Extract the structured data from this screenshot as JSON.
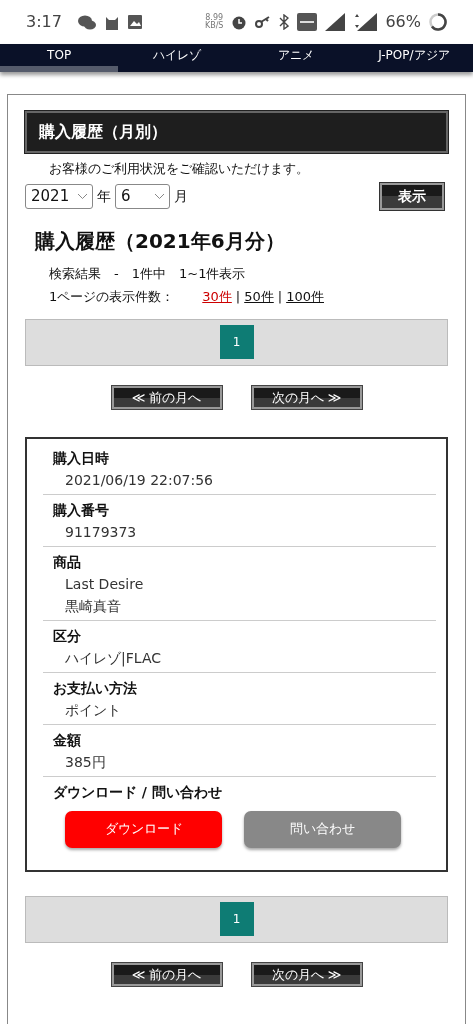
{
  "status_bar": {
    "time": "3:17",
    "net_speed": "8.99",
    "net_unit": "KB/S",
    "battery": "66%"
  },
  "nav_tabs": [
    {
      "label": "TOP",
      "selected": true
    },
    {
      "label": "ハイレゾ",
      "selected": false
    },
    {
      "label": "アニメ",
      "selected": false
    },
    {
      "label": "J-POP/アジア",
      "selected": false
    }
  ],
  "section_title": "購入履歴（月別）",
  "intro": "お客様のご利用状況をご確認いただけます。",
  "filter": {
    "year": "2021",
    "year_unit": "年",
    "month": "6",
    "month_unit": "月",
    "submit": "表示"
  },
  "results_title": "購入履歴（2021年6月分）",
  "result_summary": "検索結果　-　1件中　1~1件表示",
  "per_page_label": "1ページの表示件数：",
  "per_page_separator": "|",
  "per_page_options": [
    {
      "label": "30件",
      "selected": true
    },
    {
      "label": "50件",
      "selected": false
    },
    {
      "label": "100件",
      "selected": false
    }
  ],
  "pagination_top": [
    {
      "label": "1",
      "selected": true
    }
  ],
  "month_nav_top": {
    "prev": "≪ 前の月へ",
    "next": "次の月へ ≫"
  },
  "record": {
    "fields": [
      {
        "label": "購入日時",
        "values": [
          "2021/06/19 22:07:56"
        ]
      },
      {
        "label": "購入番号",
        "values": [
          "91179373"
        ]
      },
      {
        "label": "商品",
        "values": [
          "Last Desire",
          "黒崎真音"
        ]
      },
      {
        "label": "区分",
        "values": [
          "ハイレゾ|FLAC"
        ]
      },
      {
        "label": "お支払い方法",
        "values": [
          "ポイント"
        ]
      },
      {
        "label": "金額",
        "values": [
          "385円"
        ]
      }
    ],
    "actions_label": "ダウンロード / 問い合わせ",
    "actions": [
      {
        "label": "ダウンロード",
        "kind": "primary"
      },
      {
        "label": "問い合わせ",
        "kind": "secondary"
      }
    ]
  },
  "pagination_bottom": [
    {
      "label": "1",
      "selected": true
    }
  ],
  "month_nav_bottom": {
    "prev": "≪ 前の月へ",
    "next": "次の月へ ≫"
  }
}
